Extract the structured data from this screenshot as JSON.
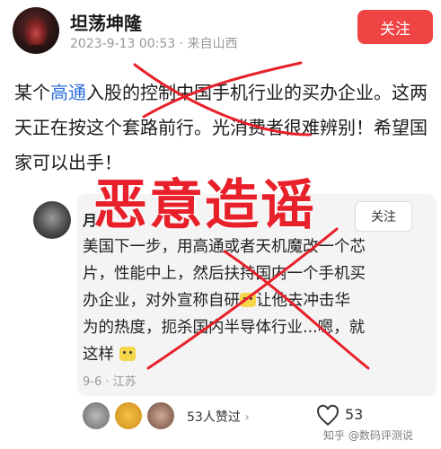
{
  "header": {
    "username": "坦荡坤隆",
    "meta": "2023-9-13 00:53 · 来自山西",
    "follow_label": "关注"
  },
  "post": {
    "before": "某个",
    "highlight": "高通",
    "after": "入股的控制中国手机行业的买办企业。这两天正在按这个套路前行。光消费者很难辨别！希望国家可以出手！"
  },
  "stamp": "恶意造谣",
  "quote": {
    "name": "月",
    "follow_label": "关注",
    "line1": "美国下一步，用高通或者天机魔改一个芯",
    "line2": "片，性能中上，然后扶持国内一个手机买",
    "line3a": "办企业，对外宣称自研",
    "line3b": "让他去冲击华",
    "line4": "为的热度，扼杀国内半导体行业...嗯，就",
    "line5": "这样",
    "date": "9-6 · 江苏"
  },
  "footer": {
    "likes": "53人赞过",
    "chevron": "›",
    "heart_count": "53",
    "watermark": "知乎 @数码评测说"
  },
  "colors": {
    "accent_red": "#ee4444",
    "stamp_red": "#e8202a",
    "link_blue": "#2d6fdb"
  }
}
